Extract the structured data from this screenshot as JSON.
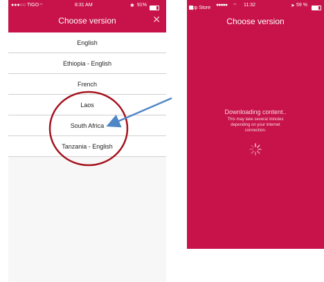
{
  "left_phone": {
    "status": {
      "carrier": "●●●○○ TIGO",
      "wifi_icon": "wifi-icon",
      "time": "8:31 AM",
      "battery": "91%"
    },
    "title": "Choose version",
    "close_symbol": "✕",
    "versions": [
      "English",
      "Ethiopia - English",
      "French",
      "Laos",
      "South Africa",
      "Tanzania - English"
    ]
  },
  "right_phone": {
    "status": {
      "back": "App Store",
      "carrier": "●●●●● ",
      "time": "11:32",
      "battery": "59 %"
    },
    "title": "Choose version",
    "download_title": "Downloading content..",
    "download_message": "This may take several minutes depending on your internet connection."
  },
  "colors": {
    "brand": "#c8134a",
    "annotation_circle": "#a3111d",
    "annotation_arrow": "#4f86c6"
  }
}
